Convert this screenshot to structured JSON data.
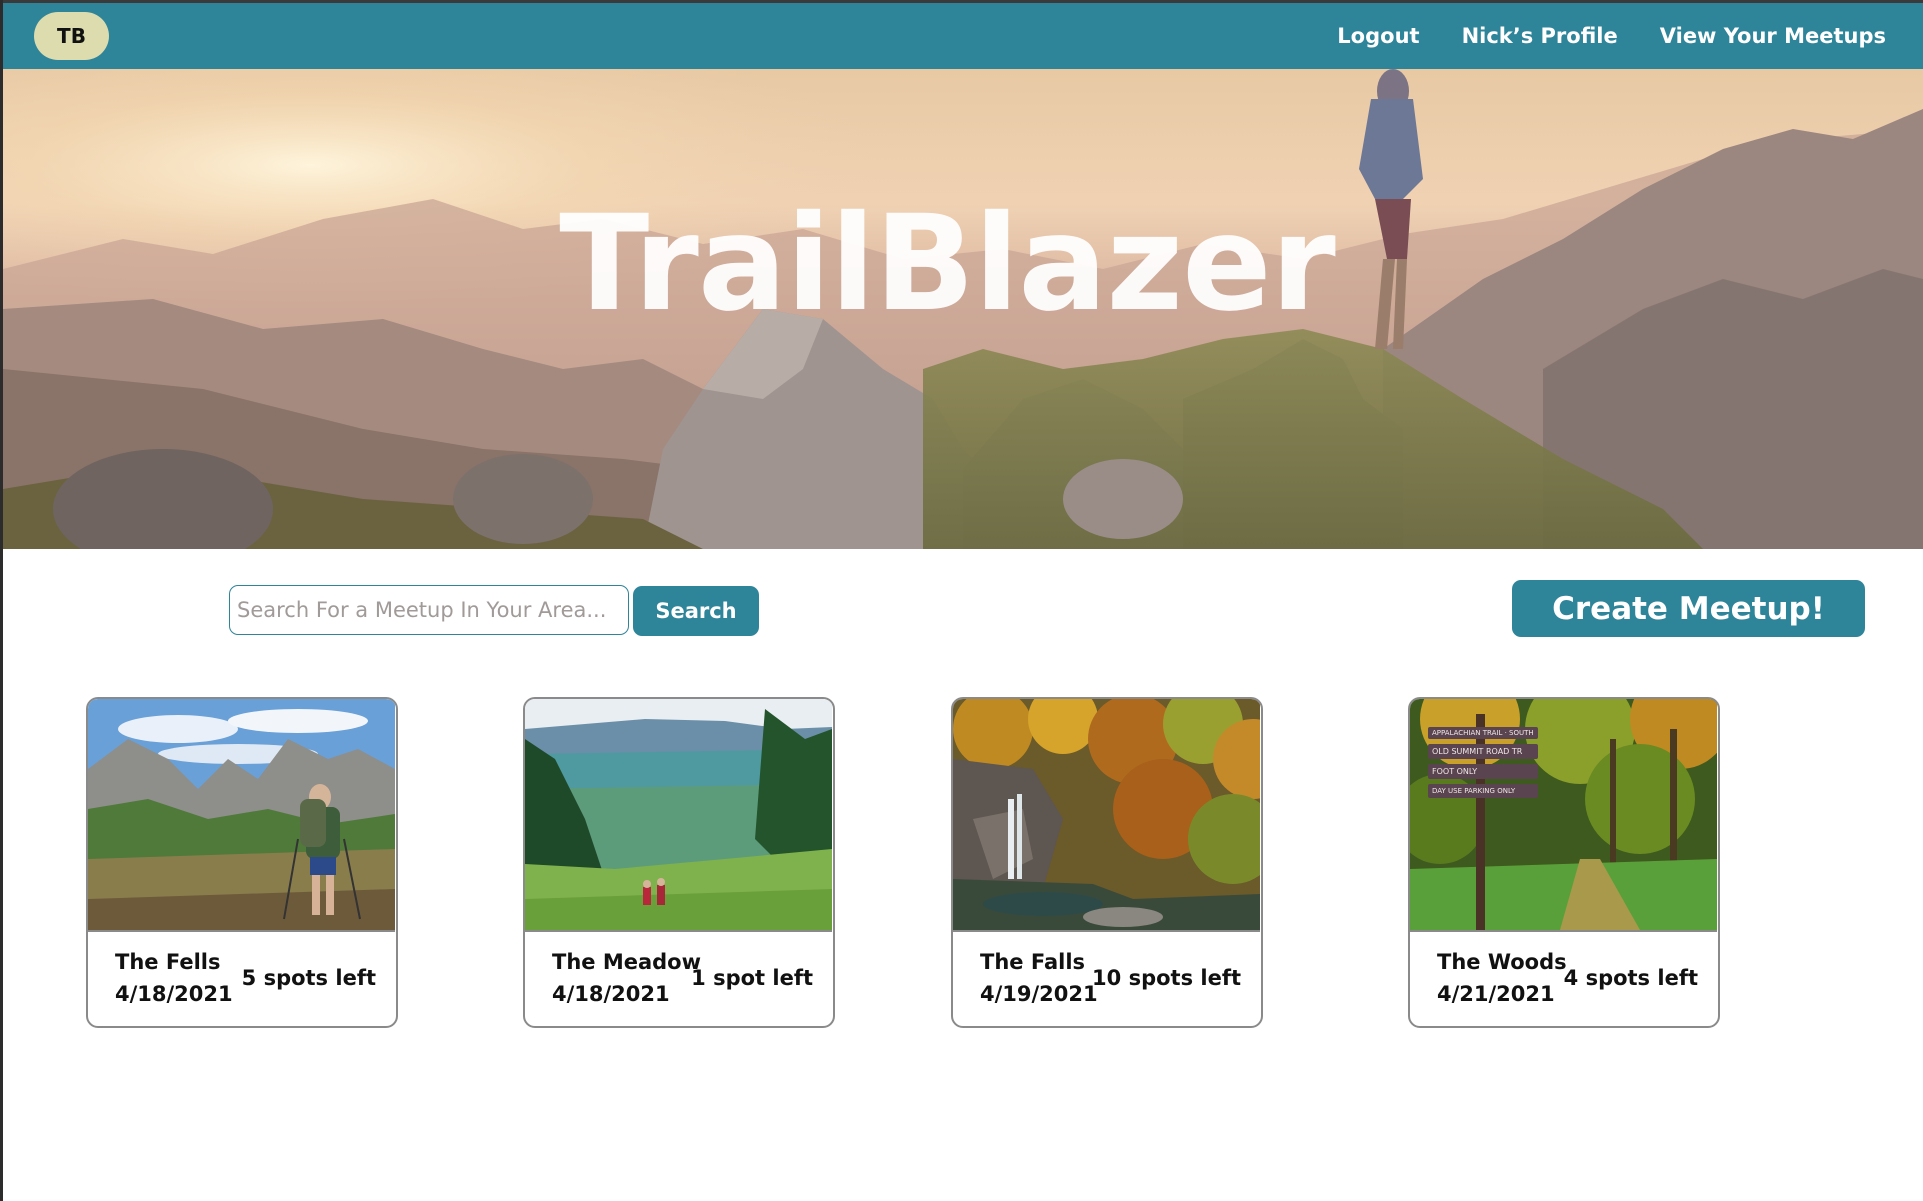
{
  "navbar": {
    "logo": "TB",
    "links": [
      "Logout",
      "Nick’s Profile",
      "View Your Meetups"
    ]
  },
  "hero": {
    "title": "TrailBlazer"
  },
  "search": {
    "placeholder": "Search For a Meetup In Your Area...",
    "button_label": "Search"
  },
  "create_button_label": "Create Meetup!",
  "meetups": [
    {
      "name": "The Fells",
      "date": "4/18/2021",
      "spots": "5 spots left",
      "photo": "hiker-in-mountain-valley"
    },
    {
      "name": "The Meadow",
      "date": "4/18/2021",
      "spots": "1 spot left",
      "photo": "meadow-overlooking-hills"
    },
    {
      "name": "The Falls",
      "date": "4/19/2021",
      "spots": "10 spots left",
      "photo": "waterfall-in-autumn-forest"
    },
    {
      "name": "The Woods",
      "date": "4/21/2021",
      "spots": "4 spots left",
      "photo": "trail-sign-in-forest"
    }
  ],
  "trail_sign": [
    "APPALACHIAN TRAIL · SOUTH",
    "OLD SUMMIT ROAD TR",
    "FOOT ONLY",
    "DAY USE PARKING ONLY"
  ],
  "colors": {
    "primary": "#2e8499",
    "logo_bg": "#dcdcae",
    "card_border": "#8a8a8a"
  }
}
